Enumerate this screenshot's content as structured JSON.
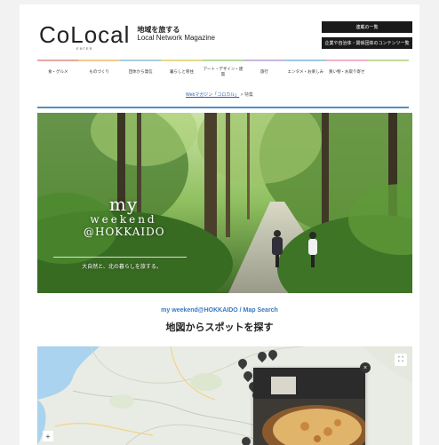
{
  "header": {
    "logo_text": "CoLocal",
    "logo_sub": "ENTER",
    "tagline_ja": "地域を旅する",
    "tagline_en": "Local Network Magazine",
    "buttons": [
      {
        "label": "連載の一覧"
      },
      {
        "label": "企業や自治体・関係団体のコンテンツ一覧"
      }
    ]
  },
  "nav": {
    "items": [
      {
        "label": "食・グルメ"
      },
      {
        "label": "ものづくり"
      },
      {
        "label": "団体から発信"
      },
      {
        "label": "暮らしと移住"
      },
      {
        "label": "アート・デザイン・建築"
      },
      {
        "label": "旅行"
      },
      {
        "label": "エンタメ・お楽しみ"
      },
      {
        "label": "買い物・お取り寄せ"
      },
      {
        "label": ""
      }
    ]
  },
  "breadcrumb": {
    "link": "Webマガジン「コロカル」",
    "separator": ">",
    "current": "特集"
  },
  "hero": {
    "title_line1": "my",
    "title_line2": "weekend",
    "title_line3": "@HOKKAIDO",
    "caption": "大自然と、北の暮らしを旅する。"
  },
  "section": {
    "label": "my weekend@HOKKAIDO / Map Search",
    "title": "地図からスポットを探す"
  },
  "map": {
    "fullscreen_icon": "fullscreen-icon",
    "zoom_label": "+",
    "close_label": "×"
  },
  "colors": {
    "accent": "#4f8fc9",
    "section_label": "#3a78c2",
    "button_bg": "#1a1a1a"
  }
}
